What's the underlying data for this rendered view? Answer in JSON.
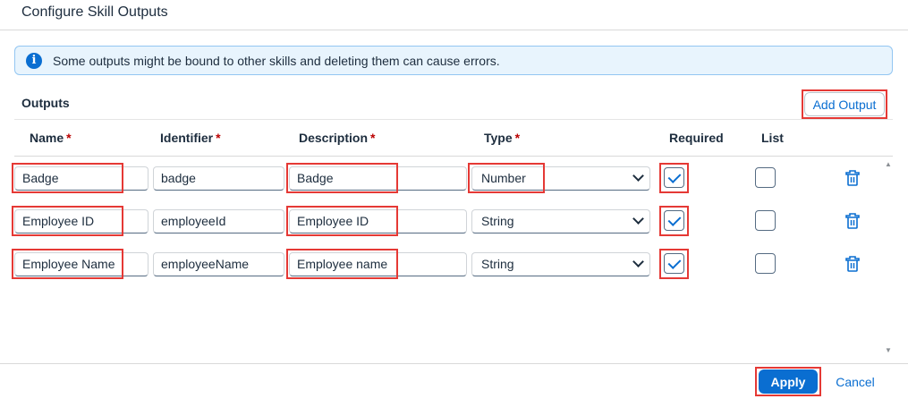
{
  "dialog": {
    "title": "Configure Skill Outputs"
  },
  "info": {
    "icon": "info-icon",
    "message": "Some outputs might be bound to other skills and deleting them can cause errors."
  },
  "outputs": {
    "section_title": "Outputs",
    "add_label": "Add Output",
    "columns": [
      {
        "label": "Name",
        "required_mark": "*"
      },
      {
        "label": "Identifier",
        "required_mark": "*"
      },
      {
        "label": "Description",
        "required_mark": "*"
      },
      {
        "label": "Type",
        "required_mark": "*"
      },
      {
        "label": "Required",
        "required_mark": ""
      },
      {
        "label": "List",
        "required_mark": ""
      }
    ],
    "rows": [
      {
        "name": "Badge",
        "identifier": "badge",
        "description": "Badge",
        "type": "Number",
        "required": true,
        "list": false
      },
      {
        "name": "Employee ID",
        "identifier": "employeeId",
        "description": "Employee ID",
        "type": "String",
        "required": true,
        "list": false
      },
      {
        "name": "Employee Name",
        "identifier": "employeeName",
        "description": "Employee name",
        "type": "String",
        "required": true,
        "list": false
      }
    ]
  },
  "footer": {
    "apply_label": "Apply",
    "cancel_label": "Cancel"
  },
  "colors": {
    "accent": "#0a6ed1",
    "highlight": "#e53935",
    "required_mark": "#bb0000",
    "info_bg": "#e8f4fd"
  }
}
